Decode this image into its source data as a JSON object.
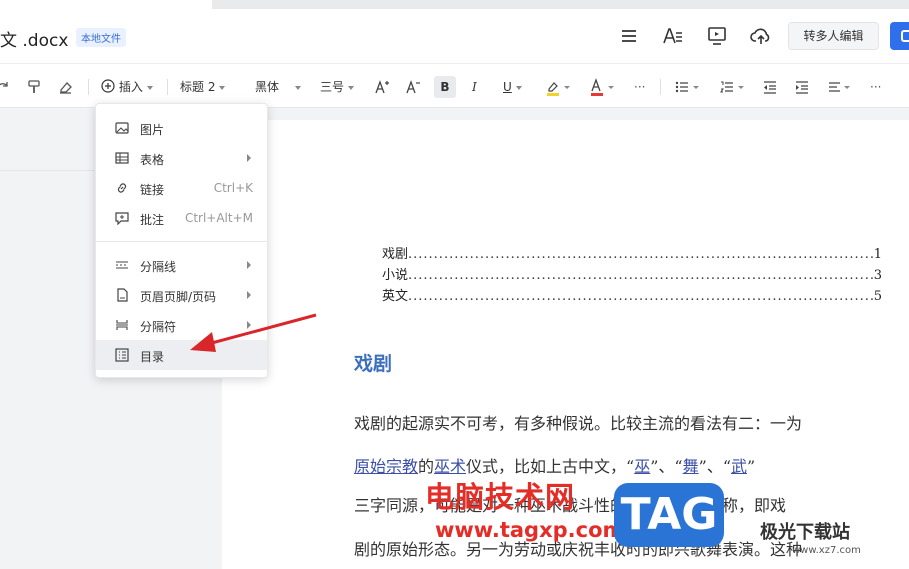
{
  "header": {
    "title": "文 .docx",
    "badge": "本地文件",
    "multi_edit_label": "转多人编辑"
  },
  "toolbar": {
    "insert_label": "插入",
    "style_value": "标题 2",
    "font_value": "黑体",
    "size_value": "三号",
    "bold": "B",
    "italic": "I",
    "underline": "U",
    "more": "···"
  },
  "insert_menu": {
    "items": [
      {
        "label": "图片",
        "shortcut": "",
        "submenu": false,
        "icon": "image-icon"
      },
      {
        "label": "表格",
        "shortcut": "",
        "submenu": true,
        "icon": "table-icon"
      },
      {
        "label": "链接",
        "shortcut": "Ctrl+K",
        "submenu": false,
        "icon": "link-icon"
      },
      {
        "label": "批注",
        "shortcut": "Ctrl+Alt+M",
        "submenu": false,
        "icon": "comment-icon"
      },
      {
        "label": "分隔线",
        "shortcut": "",
        "submenu": true,
        "icon": "divider-icon"
      },
      {
        "label": "页眉页脚/页码",
        "shortcut": "",
        "submenu": true,
        "icon": "header-footer-icon"
      },
      {
        "label": "分隔符",
        "shortcut": "",
        "submenu": true,
        "icon": "break-icon"
      },
      {
        "label": "目录",
        "shortcut": "",
        "submenu": false,
        "icon": "toc-icon"
      }
    ]
  },
  "document": {
    "toc": [
      {
        "title": "戏剧",
        "dots": "..............................................................................................",
        "page": "1"
      },
      {
        "title": "小说",
        "dots": "..............................................................................................",
        "page": "3"
      },
      {
        "title": "英文",
        "dots": "..............................................................................................",
        "page": "5"
      }
    ],
    "heading": "戏剧",
    "para_line1": "戏剧的起源实不可考，有多种假说。比较主流的看法有二：一为",
    "para_line2_a": "原始宗教",
    "para_line2_b": "的",
    "para_line2_c": "巫术",
    "para_line2_d": "仪式，比如上古中文，“",
    "para_line2_e": "巫",
    "para_line2_f": "”、“",
    "para_line2_g": "舞",
    "para_line2_h": "”、“",
    "para_line2_i": "武",
    "para_line2_j": "”",
    "para_line3": "三字同源，可能是对一种巫术战斗性的宗教活动的合称，即戏",
    "para_line4": "剧的原始形态。另一为劳动或庆祝丰收时的即兴歌舞表演。这种"
  },
  "watermark": {
    "site_name": "电脑技术网",
    "site_url": "www.tagxp.com",
    "tag": "TAG",
    "brand": "极光下载站",
    "brand_url": "www.xz7.com"
  },
  "colors": {
    "accent": "#2f6fec",
    "heading": "#3d6fbf",
    "arrow": "#d9262b"
  }
}
